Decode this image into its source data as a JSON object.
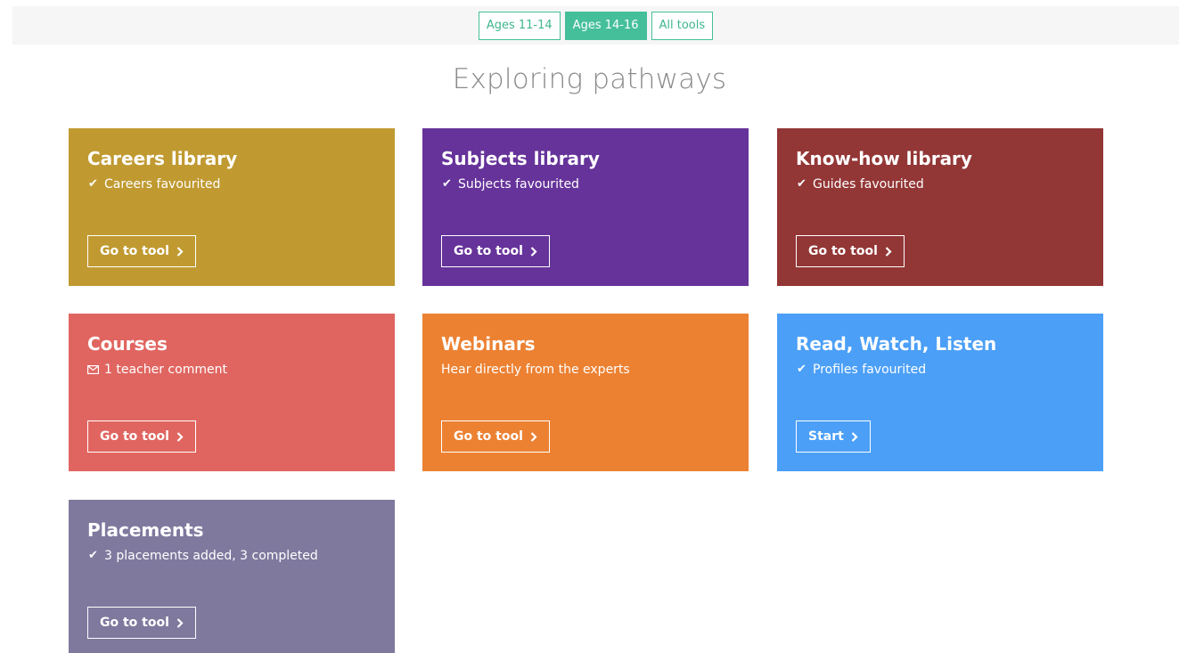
{
  "filters": [
    {
      "label": "Ages 11-14",
      "active": false
    },
    {
      "label": "Ages 14-16",
      "active": true
    },
    {
      "label": "All tools",
      "active": false
    }
  ],
  "page_title": "Exploring pathways",
  "colors": {
    "accent": "#45bf9a",
    "careers": "#c09a31",
    "subjects": "#66339a",
    "knowhow": "#933636",
    "courses": "#e06560",
    "webinars": "#ec8132",
    "read_watch_listen": "#4b9ff7",
    "placements": "#7f799e"
  },
  "cards": [
    {
      "title": "Careers library",
      "status": "Careers favourited",
      "status_icon": "check-icon",
      "button": "Go to tool"
    },
    {
      "title": "Subjects library",
      "status": "Subjects favourited",
      "status_icon": "check-icon",
      "button": "Go to tool"
    },
    {
      "title": "Know-how library",
      "status": "Guides favourited",
      "status_icon": "check-icon",
      "button": "Go to tool"
    },
    {
      "title": "Courses",
      "status": "1 teacher comment",
      "status_icon": "envelope-icon",
      "button": "Go to tool"
    },
    {
      "title": "Webinars",
      "status": "Hear directly from the experts",
      "status_icon": "",
      "button": "Go to tool"
    },
    {
      "title": "Read, Watch, Listen",
      "status": "Profiles favourited",
      "status_icon": "check-icon",
      "button": "Start"
    },
    {
      "title": "Placements",
      "status": "3 placements added, 3 completed",
      "status_icon": "check-icon",
      "button": "Go to tool"
    }
  ]
}
